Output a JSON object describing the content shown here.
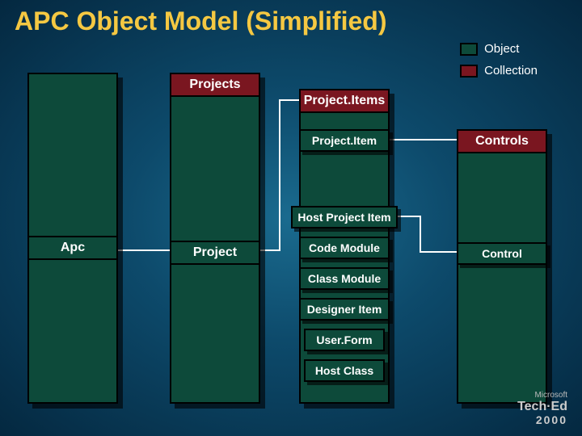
{
  "title": "APC Object Model (Simplified)",
  "legend": {
    "object": "Object",
    "collection": "Collection"
  },
  "columns": {
    "apc": {
      "label": "Apc",
      "type": "object"
    },
    "projects": {
      "head": "Projects",
      "mid": "Project",
      "head_type": "collection",
      "mid_type": "object"
    },
    "projectitems": {
      "head": "Project.Items",
      "head_type": "collection"
    },
    "controls": {
      "head": "Controls",
      "head_type": "collection"
    }
  },
  "boxes": {
    "projectitem": "Project.Item",
    "host_project_item": "Host Project Item",
    "code_module": "Code Module",
    "class_module": "Class Module",
    "designer_item": "Designer Item",
    "user_form": "User.Form",
    "host_class": "Host Class",
    "control": "Control"
  },
  "branding": {
    "company": "Microsoft",
    "event": "Tech·Ed",
    "year": "2000"
  },
  "colors": {
    "object_fill": "#0d4a3a",
    "collection_fill": "#7a1620",
    "title": "#f5c842"
  }
}
